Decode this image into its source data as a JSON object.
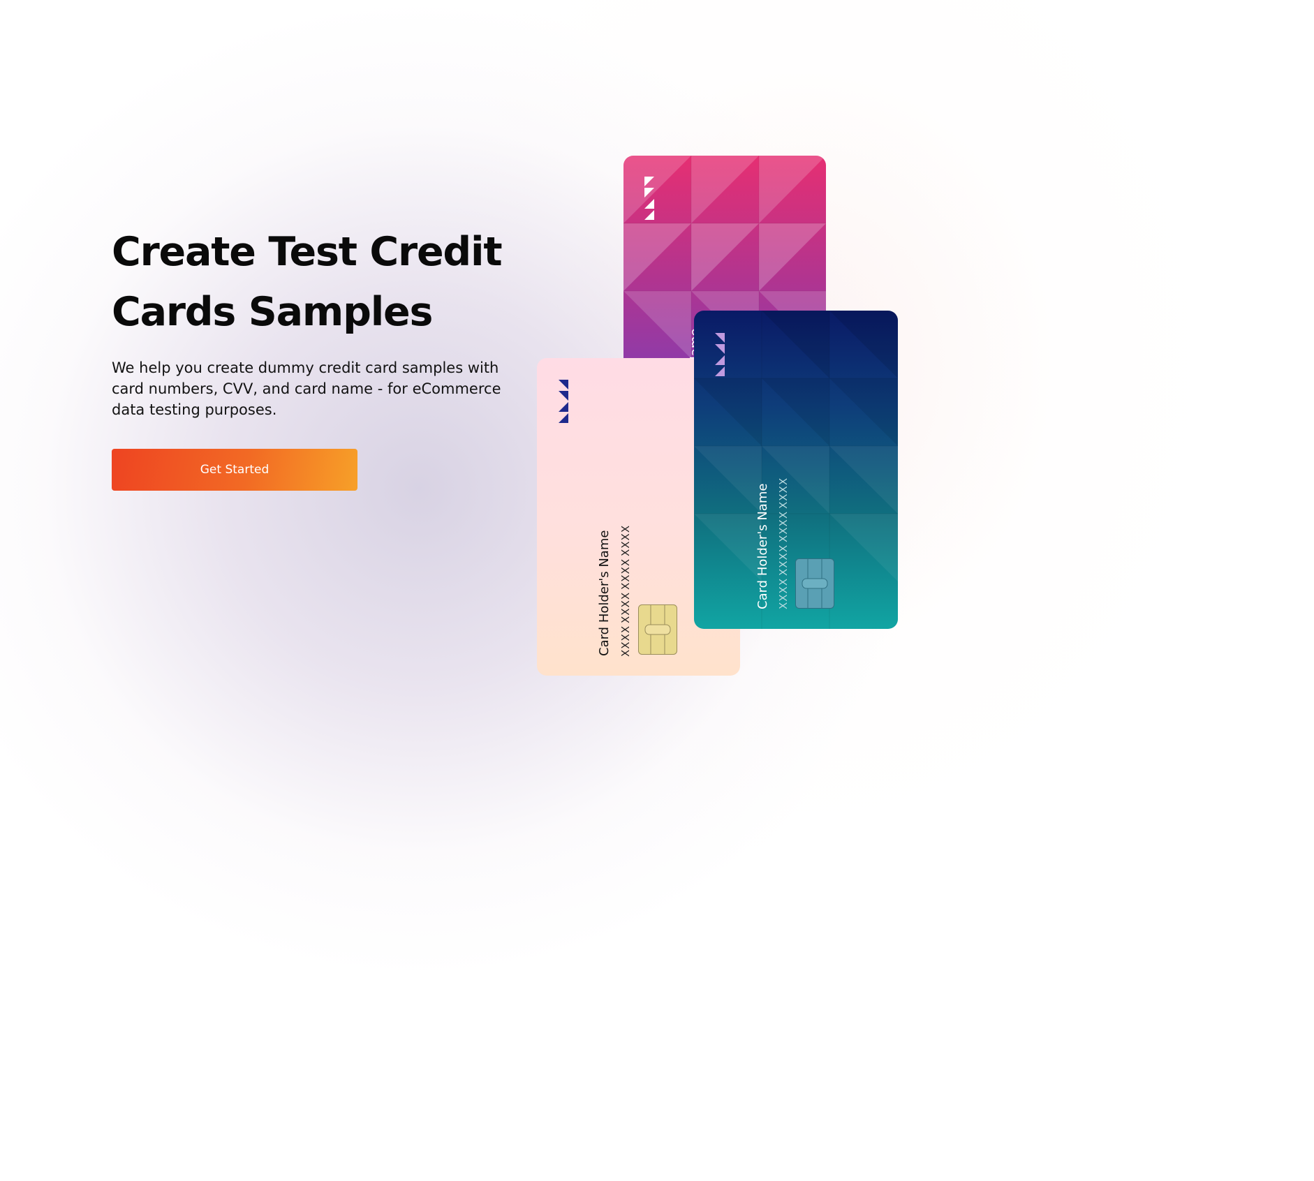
{
  "hero": {
    "headline_line1": "Create Test Credit",
    "headline_line2": "Cards Samples",
    "description": "We help you create dummy credit card samples with card numbers, CVV, and card name - for eCommerce data testing purposes.",
    "cta_label": "Get Started"
  },
  "cards": {
    "pink": {
      "holder": "Card Holder's Name"
    },
    "peach": {
      "holder": "Card Holder's Name",
      "groups": [
        "XXXX",
        "XXXX",
        "XXXX",
        "XXXX"
      ]
    },
    "teal": {
      "holder": "Card Holder's Name",
      "groups": [
        "XXXX",
        "XXXX",
        "XXXX",
        "XXXX"
      ]
    }
  },
  "colors": {
    "cta_start": "#ee4422",
    "cta_end": "#f7a028",
    "pink_card_top": "#e62f72",
    "pink_card_bottom": "#5746d6",
    "teal_card_top": "#0a1a66",
    "teal_card_bottom": "#11a5a3",
    "peach_card": "#ffe0dd"
  }
}
